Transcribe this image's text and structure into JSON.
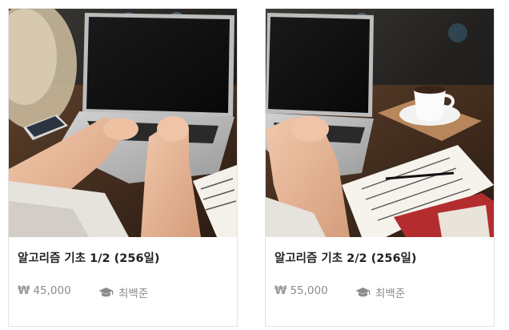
{
  "courses": [
    {
      "title": "알고리즘 기초 1/2 (256일)",
      "price": "45,000",
      "teacher": "최백준",
      "thumbnail": "laptop-typing-photo"
    },
    {
      "title": "알고리즘 기초 2/2 (256일)",
      "price": "55,000",
      "teacher": "최백준",
      "thumbnail": "laptop-coffee-photo"
    }
  ],
  "icons": {
    "price": "won-icon",
    "teacher": "graduation-cap-icon"
  },
  "currency_symbol": "₩"
}
